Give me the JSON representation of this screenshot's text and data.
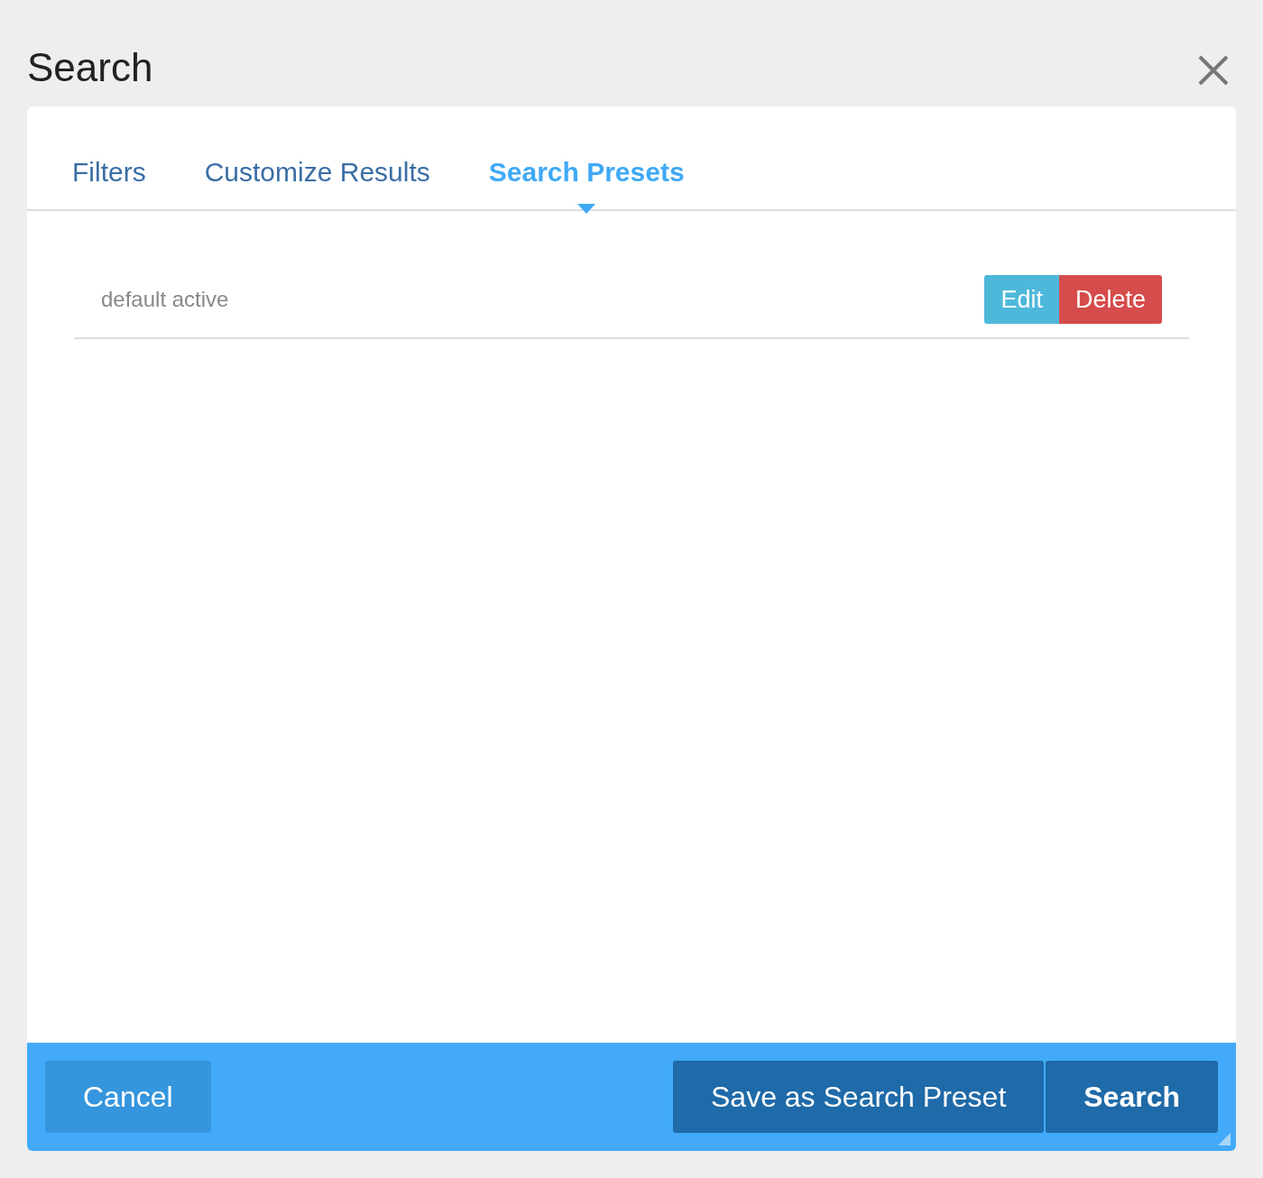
{
  "title": "Search",
  "tabs": [
    {
      "label": "Filters",
      "selected": false
    },
    {
      "label": "Customize Results",
      "selected": false
    },
    {
      "label": "Search Presets",
      "selected": true
    }
  ],
  "presets": [
    {
      "name": "default active",
      "actions": [
        {
          "label": "Edit",
          "kind": "edit"
        },
        {
          "label": "Delete",
          "kind": "delete"
        }
      ]
    }
  ],
  "footer": {
    "buttons": [
      {
        "label": "Cancel",
        "kind": "cancel"
      },
      {
        "label": "Save as Search Preset",
        "kind": "save"
      },
      {
        "label": "Search",
        "kind": "primary"
      }
    ]
  }
}
